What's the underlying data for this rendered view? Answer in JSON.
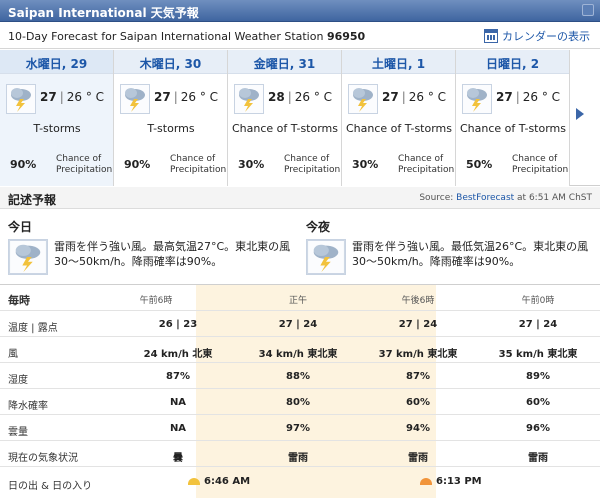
{
  "window": {
    "title": "Saipan International 天気予報"
  },
  "header": {
    "forecast_prefix": "10-Day Forecast for Saipan International Weather Station ",
    "station_id": "96950",
    "calendar_label": "カレンダーの表示"
  },
  "days": [
    {
      "label": "水曜日, 29",
      "high": "27",
      "low": "26",
      "unit": "° C",
      "condition": "T-storms",
      "precip": "90%",
      "precip_label_1": "Chance of",
      "precip_label_2": "Precipitation",
      "icon": "thunderstorm-icon"
    },
    {
      "label": "木曜日, 30",
      "high": "27",
      "low": "26",
      "unit": "° C",
      "condition": "T-storms",
      "precip": "90%",
      "precip_label_1": "Chance of",
      "precip_label_2": "Precipitation",
      "icon": "thunderstorm-icon"
    },
    {
      "label": "金曜日, 31",
      "high": "28",
      "low": "26",
      "unit": "° C",
      "condition": "Chance of T-storms",
      "precip": "30%",
      "precip_label_1": "Chance of",
      "precip_label_2": "Precipitation",
      "icon": "thunderstorm-icon"
    },
    {
      "label": "土曜日, 1",
      "high": "27",
      "low": "26",
      "unit": "° C",
      "condition": "Chance of T-storms",
      "precip": "30%",
      "precip_label_1": "Chance of",
      "precip_label_2": "Precipitation",
      "icon": "thunderstorm-icon"
    },
    {
      "label": "日曜日, 2",
      "high": "27",
      "low": "26",
      "unit": "° C",
      "condition": "Chance of T-storms",
      "precip": "50%",
      "precip_label_1": "Chance of",
      "precip_label_2": "Precipitation",
      "icon": "thunderstorm-icon"
    }
  ],
  "description": {
    "title": "記述予報",
    "source_prefix": "Source: ",
    "source_link": "BestForecast",
    "source_suffix": " at 6:51 AM ChST"
  },
  "today": {
    "name": "今日",
    "text": "雷雨を伴う強い風。最高気温27°C。東北東の風 30〜50km/h。降雨確率は90%。"
  },
  "tonight": {
    "name": "今夜",
    "text": "雷雨を伴う強い風。最低気温26°C。東北東の風 30〜50km/h。降雨確率は90%。"
  },
  "hourly": {
    "header_label": "毎時",
    "times": [
      "午前6時",
      "正午",
      "午後6時",
      "午前0時"
    ],
    "rows": [
      {
        "label": "温度 | 露点",
        "values": [
          "26 | 23",
          "27 | 24",
          "27 | 24",
          "27 | 24"
        ]
      },
      {
        "label": "風",
        "values": [
          "24 km/h 北東",
          "34 km/h 東北東",
          "37 km/h 東北東",
          "35 km/h 東北東"
        ]
      },
      {
        "label": "湿度",
        "values": [
          "87%",
          "88%",
          "87%",
          "89%"
        ]
      },
      {
        "label": "降水確率",
        "values": [
          "NA",
          "80%",
          "60%",
          "60%"
        ]
      },
      {
        "label": "雲量",
        "values": [
          "NA",
          "97%",
          "94%",
          "96%"
        ]
      },
      {
        "label": "現在の気象状況",
        "values": [
          "曇",
          "雷雨",
          "雷雨",
          "雷雨"
        ]
      }
    ],
    "sun_label": "日の出 & 日の入り",
    "sunrise": "6:46 AM",
    "sunset": "6:13 PM"
  }
}
